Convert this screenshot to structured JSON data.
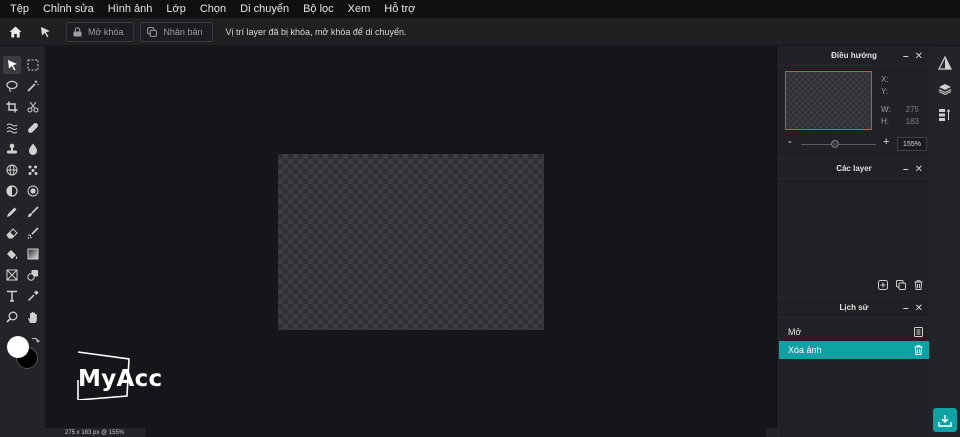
{
  "menubar": {
    "items": [
      {
        "label": "Tệp"
      },
      {
        "label": "Chỉnh sửa"
      },
      {
        "label": "Hình ảnh"
      },
      {
        "label": "Lớp"
      },
      {
        "label": "Chọn"
      },
      {
        "label": "Di chuyển"
      },
      {
        "label": "Bộ lọc"
      },
      {
        "label": "Xem"
      },
      {
        "label": "Hỗ trợ"
      }
    ]
  },
  "toolbar": {
    "unlock_label": "Mở khóa",
    "duplicate_label": "Nhân bản",
    "message": "Vị trí layer đã bị khóa, mở khóa để di chuyển."
  },
  "colors": {
    "foreground": "#ffffff",
    "background": "#000000",
    "accent": "#0fa2a4"
  },
  "canvas": {
    "status": "275 x 183 px @ 155%"
  },
  "watermark": {
    "text": "MyAcc"
  },
  "navigator": {
    "title": "Điều hướng",
    "x_label": "X:",
    "y_label": "Y:",
    "w_label": "W:",
    "h_label": "H:",
    "w_value": "275",
    "h_value": "183",
    "zoom_minus": "-",
    "zoom_plus": "+",
    "zoom": "155%"
  },
  "layers": {
    "title": "Các layer"
  },
  "history": {
    "title": "Lịch sử",
    "items": [
      {
        "label": "Mở"
      },
      {
        "label": "Xóa ảnh"
      }
    ]
  }
}
